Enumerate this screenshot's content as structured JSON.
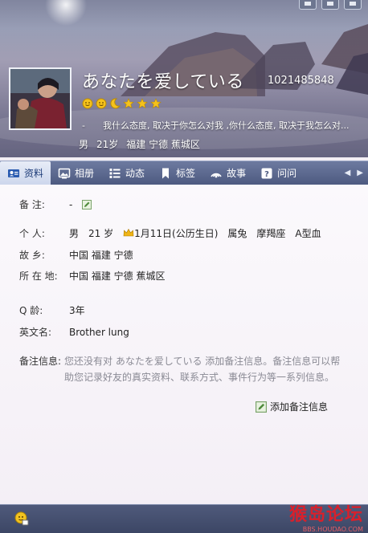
{
  "header": {
    "nickname": "あなたを爱している",
    "qq_number": "1021485848",
    "level_icons": [
      "sun-icon",
      "sun-icon",
      "moon-icon",
      "star-icon",
      "star-icon",
      "star-icon"
    ],
    "signature_dash": "-",
    "signature": "我什么态度, 取决于你怎么对我 ,你什么态度, 取决于我怎么对...",
    "brief": {
      "gender": "男",
      "age": "21岁",
      "location": "福建 宁德 蕉城区"
    }
  },
  "tabs": [
    {
      "label": "资料",
      "icon": "profile-card-icon",
      "active": true
    },
    {
      "label": "相册",
      "icon": "photo-album-icon",
      "active": false
    },
    {
      "label": "动态",
      "icon": "feed-list-icon",
      "active": false
    },
    {
      "label": "标签",
      "icon": "bookmark-icon",
      "active": false
    },
    {
      "label": "故事",
      "icon": "signal-icon",
      "active": false
    },
    {
      "label": "问问",
      "icon": "question-icon",
      "active": false
    }
  ],
  "profile": {
    "remark": {
      "label": "备    注:",
      "value": "-"
    },
    "personal": {
      "label": "个    人:",
      "gender": "男",
      "age": "21 岁",
      "birthday": "1月11日(公历生日)",
      "zodiac": "属兔",
      "star_sign": "摩羯座",
      "blood_type": "A型血"
    },
    "hometown": {
      "label": "故    乡:",
      "value": "中国 福建 宁德"
    },
    "residence": {
      "label": "所 在 地:",
      "value": "中国 福建 宁德 蕉城区"
    },
    "qage": {
      "label": "Q    龄:",
      "value": "3年"
    },
    "english_name": {
      "label": "英文名:",
      "value": "Brother lung"
    },
    "note_info": {
      "label": "备注信息:",
      "text": "您还没有对 あなたを爱している 添加备注信息。备注信息可以帮助您记录好友的真实资料、联系方式、事件行为等一系列信息。"
    },
    "add_note_label": "添加备注信息"
  },
  "footer": {
    "watermark": "猴岛论坛",
    "watermark_url": "BBS.HOUDAO.COM"
  },
  "colors": {
    "tab_bar": "#4d5a80",
    "active_tab": "#ccd6ec",
    "note_text": "#8a8a94",
    "watermark": "#d9202b"
  }
}
